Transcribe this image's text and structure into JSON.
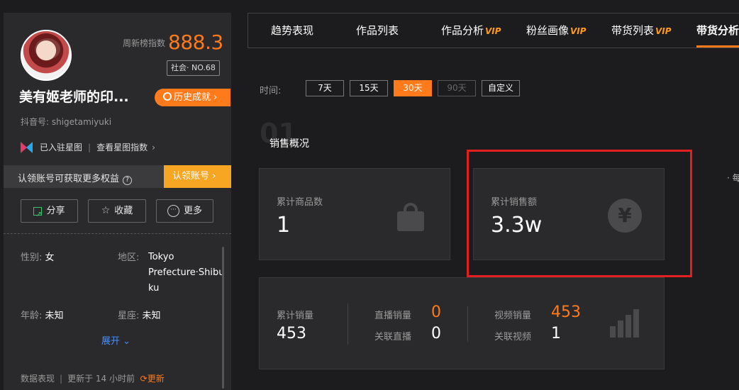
{
  "profile": {
    "weekly_label": "周新榜指数",
    "weekly_score": "888.3",
    "rank": "社会· NO.68",
    "name": "美有姬老师的印...",
    "history_btn": "历史成就",
    "dy_id": "抖音号: shigetamiyuki",
    "star_joined": "已入驻星图",
    "star_view": "查看星图指数",
    "claim_text": "认领账号可获取更多权益",
    "claim_btn": "认领账号",
    "share": "分享",
    "favorite": "收藏",
    "more": "更多",
    "gender_k": "性别:",
    "gender_v": "女",
    "region_k": "地区:",
    "region_v1": "Tokyo",
    "region_v2": "Prefecture·Shibu",
    "region_v3": "ku",
    "age_k": "年龄:",
    "age_v": "未知",
    "zodiac_k": "星座:",
    "zodiac_v": "未知",
    "expand": "展开",
    "data_label": "数据表现",
    "updated": "更新于 14 小时前",
    "refresh": "更新"
  },
  "tabs": [
    {
      "label": "趋势表现",
      "vip": ""
    },
    {
      "label": "作品列表",
      "vip": ""
    },
    {
      "label": "作品分析",
      "vip": "VIP"
    },
    {
      "label": "粉丝画像",
      "vip": "VIP"
    },
    {
      "label": "带货列表",
      "vip": "VIP"
    },
    {
      "label": "带货分析",
      "vip": ""
    }
  ],
  "time": {
    "label": "时间:",
    "options": [
      "7天",
      "15天",
      "30天",
      "90天",
      "自定义"
    ],
    "selected": "30天"
  },
  "section": {
    "num": "01",
    "title": "销售概况",
    "right_cut": "· 每"
  },
  "cards": {
    "goods_label": "累计商品数",
    "goods_value": "1",
    "sales_amount_label": "累计销售额",
    "sales_amount_value": "3.3w"
  },
  "stats": {
    "total_sales_label": "累计销量",
    "total_sales_value": "453",
    "live_sales_label": "直播销量",
    "live_sales_value": "0",
    "linked_live_label": "关联直播",
    "linked_live_value": "0",
    "video_sales_label": "视频销量",
    "video_sales_value": "453",
    "linked_video_label": "关联视频",
    "linked_video_value": "1"
  },
  "colors": {
    "accent": "#ff7a1a",
    "highlight": "#e32020",
    "background": "#1c1c1e",
    "panel": "#2a2a2c"
  }
}
